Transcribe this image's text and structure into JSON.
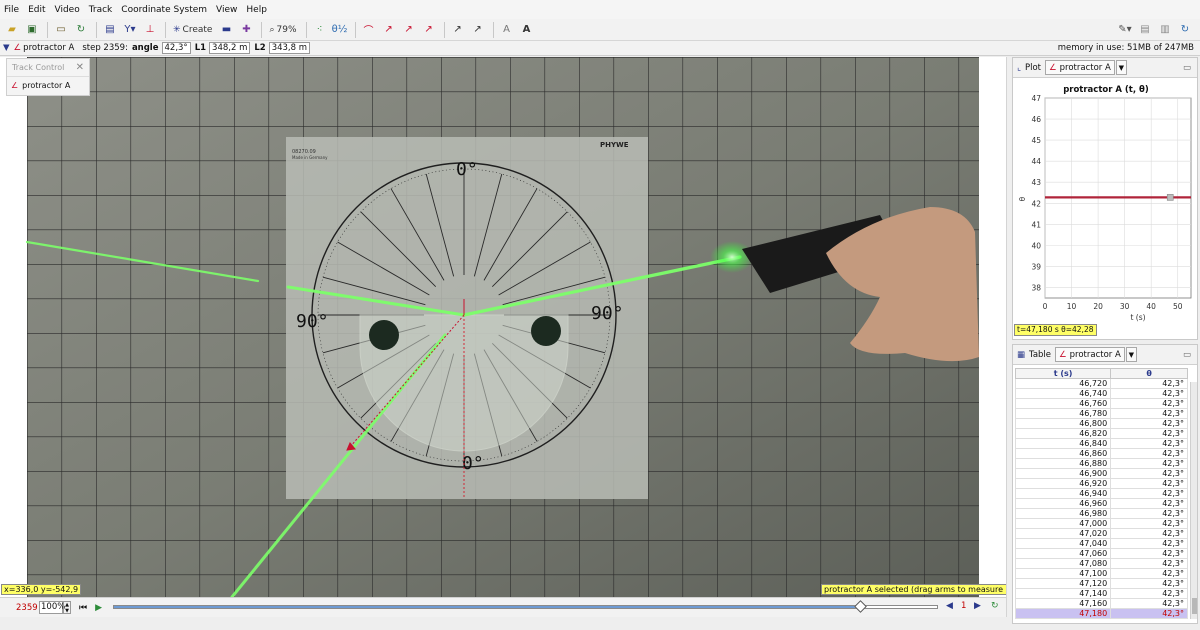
{
  "menu": [
    "File",
    "Edit",
    "Video",
    "Track",
    "Coordinate System",
    "View",
    "Help"
  ],
  "toolbar": {
    "create_label": "Create",
    "zoom_label": "79%"
  },
  "trackbar": {
    "track_name": "protractor A",
    "step_label": "step 2359:",
    "angle_label": "angle",
    "angle_value": "42,3°",
    "l1_label": "L1",
    "l1_value": "348,2 m",
    "l2_label": "L2",
    "l2_value": "343,8 m",
    "memory": "memory in use: 51MB of 247MB"
  },
  "track_control": {
    "title": "Track Control",
    "item": "protractor A"
  },
  "video": {
    "brand": "PHYWE",
    "catalog": "08270.09",
    "made_in": "Made in Germany",
    "scale_top": "0°",
    "scale_left": "90°",
    "scale_right": "90°",
    "scale_bottom": "0°"
  },
  "coords_readout": "x=336,0  y=-542,9",
  "status_message": "protractor A selected (drag arms to measure angles)",
  "player": {
    "frame": "2359",
    "rate": "100%",
    "step_size": "1"
  },
  "plot": {
    "tab_label": "Plot",
    "track_button": "protractor A",
    "title": "protractor A (t, θ)",
    "xlabel": "t (s)",
    "ylabel": "θ",
    "readout": "t=47,180 s  θ=42,28"
  },
  "chart_data": {
    "type": "line",
    "title": "protractor A (t, θ)",
    "xlabel": "t (s)",
    "ylabel": "θ",
    "xlim": [
      0,
      55
    ],
    "ylim": [
      37.5,
      47
    ],
    "x_ticks": [
      0,
      10,
      20,
      30,
      40,
      50
    ],
    "y_ticks": [
      38,
      39,
      40,
      41,
      42,
      43,
      44,
      45,
      46,
      47
    ],
    "grid": true,
    "series": [
      {
        "x": [
          0,
          10,
          20,
          30,
          40,
          47.18,
          55
        ],
        "y": [
          42.28,
          42.28,
          42.28,
          42.28,
          42.28,
          42.28,
          42.28
        ]
      }
    ],
    "selected_point": {
      "x": 47.18,
      "y": 42.28
    }
  },
  "table": {
    "tab_label": "Table",
    "track_button": "protractor A",
    "columns": [
      "t (s)",
      "θ"
    ],
    "rows": [
      [
        "46,720",
        "42,3°"
      ],
      [
        "46,740",
        "42,3°"
      ],
      [
        "46,760",
        "42,3°"
      ],
      [
        "46,780",
        "42,3°"
      ],
      [
        "46,800",
        "42,3°"
      ],
      [
        "46,820",
        "42,3°"
      ],
      [
        "46,840",
        "42,3°"
      ],
      [
        "46,860",
        "42,3°"
      ],
      [
        "46,880",
        "42,3°"
      ],
      [
        "46,900",
        "42,3°"
      ],
      [
        "46,920",
        "42,3°"
      ],
      [
        "46,940",
        "42,3°"
      ],
      [
        "46,960",
        "42,3°"
      ],
      [
        "46,980",
        "42,3°"
      ],
      [
        "47,000",
        "42,3°"
      ],
      [
        "47,020",
        "42,3°"
      ],
      [
        "47,040",
        "42,3°"
      ],
      [
        "47,060",
        "42,3°"
      ],
      [
        "47,080",
        "42,3°"
      ],
      [
        "47,100",
        "42,3°"
      ],
      [
        "47,120",
        "42,3°"
      ],
      [
        "47,140",
        "42,3°"
      ],
      [
        "47,160",
        "42,3°"
      ],
      [
        "47,180",
        "42,3°"
      ]
    ],
    "selected_row": 23
  },
  "colors": {
    "laser": "#7dff6a",
    "track_accent": "#c8102e",
    "readout_bg": "#ffff66",
    "plot_line": "#b0243a"
  }
}
